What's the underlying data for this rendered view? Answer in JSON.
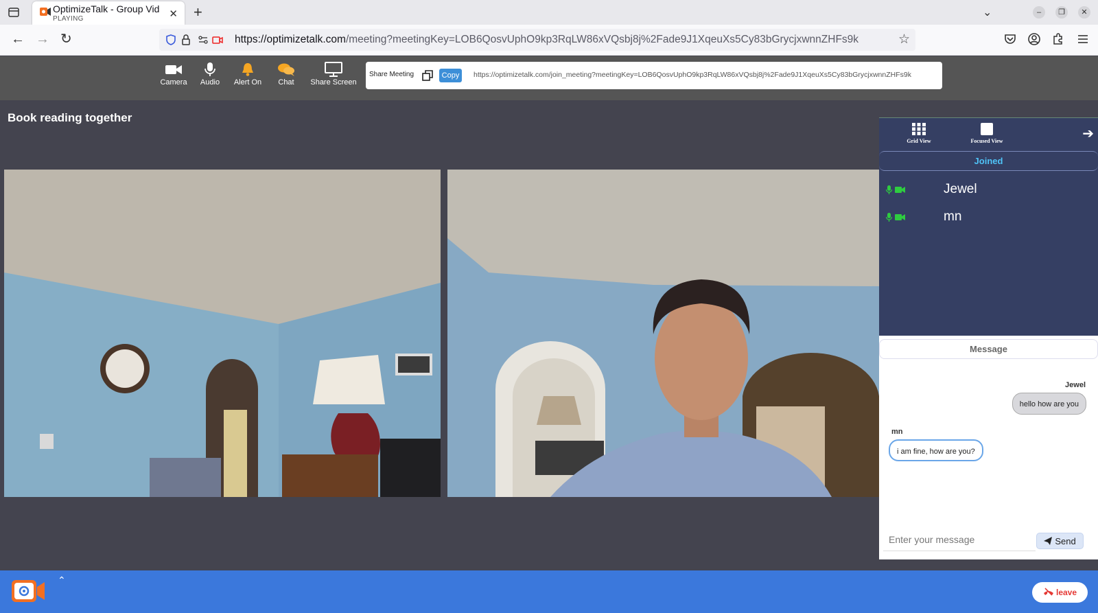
{
  "browser": {
    "tab": {
      "title": "OptimizeTalk - Group Vid",
      "subtitle": "PLAYING",
      "favicon": "optimizetalk-favicon"
    },
    "url": {
      "host": "https://optimizetalk.com",
      "path": "/meeting?meetingKey=LOB6QosvUphO9kp3RqLW86xVQsbj8j%2Fade9J1XqeuXs5Cy83bGrycjxwnnZHFs9k"
    },
    "icons": [
      "tab-list-icon",
      "close-icon",
      "plus-icon",
      "chevron-down-icon",
      "minimize-icon",
      "restore-icon",
      "window-close-icon",
      "back-icon",
      "forward-icon",
      "reload-icon",
      "shield-icon",
      "lock-icon",
      "permissions-icon",
      "camera-blocked-icon",
      "star-icon",
      "pocket-icon",
      "account-icon",
      "extensions-icon",
      "menu-icon"
    ]
  },
  "toolbar": {
    "items": [
      {
        "label": "Camera",
        "icon": "camera-icon"
      },
      {
        "label": "Audio",
        "icon": "microphone-icon"
      },
      {
        "label": "Alert On",
        "icon": "bell-icon"
      },
      {
        "label": "Chat",
        "icon": "chat-icon"
      },
      {
        "label": "Share Screen",
        "icon": "monitor-icon"
      }
    ],
    "share": {
      "label": "Share Meeting",
      "copy_label": "Copy",
      "url": "https://optimizetalk.com/join_meeting?meetingKey=LOB6QosvUphO9kp3RqLW86xVQsbj8j%2Fade9J1XqeuXs5Cy83bGrycjxwnnZHFs9k"
    }
  },
  "meeting": {
    "title": "Book reading together"
  },
  "panel": {
    "grid_view": "Grid View",
    "focused_view": "Focused View",
    "joined_header": "Joined",
    "participants": [
      {
        "name": "Jewel"
      },
      {
        "name": "mn"
      }
    ]
  },
  "chat": {
    "header": "Message",
    "messages": [
      {
        "sender": "Jewel",
        "text": "hello how are you",
        "side": "right"
      },
      {
        "sender": "mn",
        "text": "i am fine, how are you?",
        "side": "left"
      }
    ],
    "input_placeholder": "Enter your message",
    "send_label": "Send"
  },
  "bottom": {
    "leave_label": "leave"
  },
  "colors": {
    "toolbar_bg": "#555555",
    "meeting_bg": "#44444f",
    "panel_bg": "#353f63",
    "joined_accent": "#4fc3f7",
    "status_green": "#2ecc40",
    "bottom_bar": "#3b78dc",
    "alert_orange": "#f5a623",
    "copy_blue": "#3d8fd8",
    "leave_red": "#e53935"
  }
}
